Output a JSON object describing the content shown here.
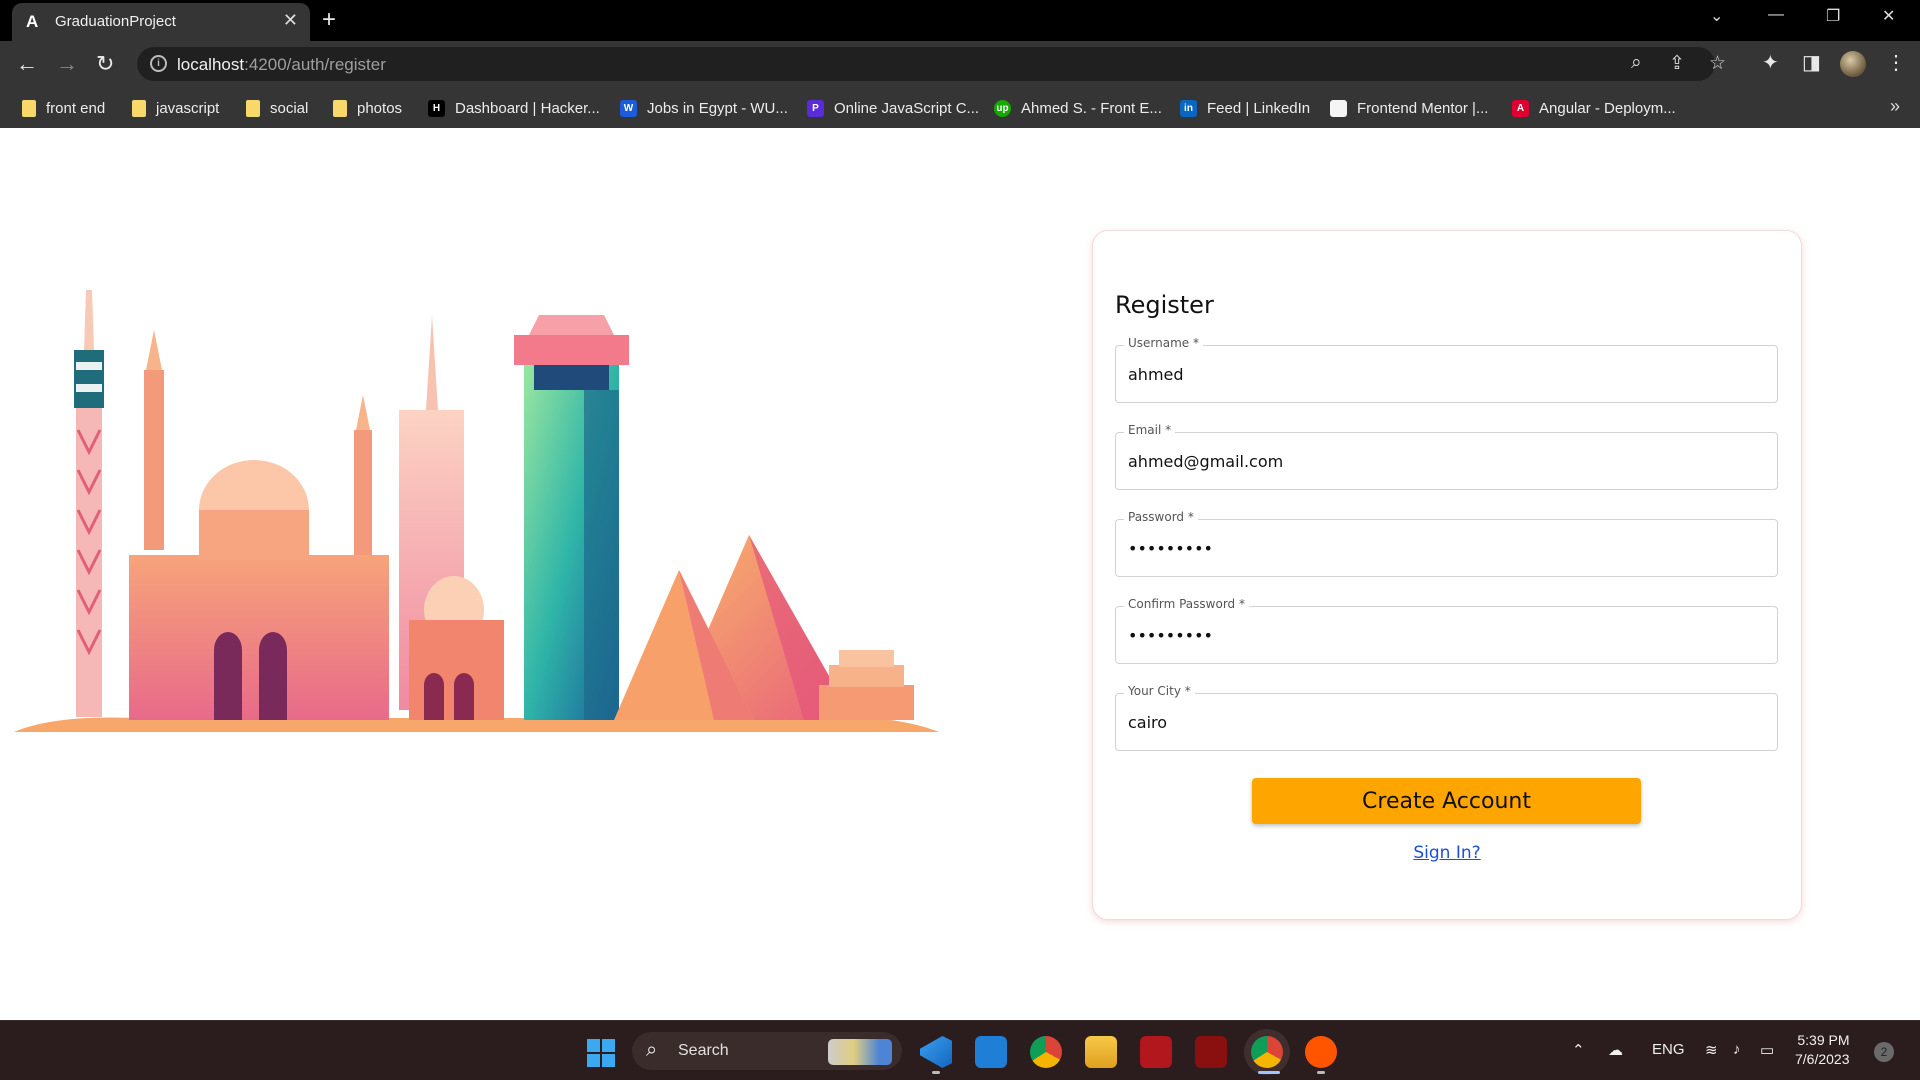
{
  "browser": {
    "tab_title": "GraduationProject",
    "tab_favicon": "A",
    "url_host": "localhost",
    "url_rest": ":4200/auth/register",
    "bookmarks": [
      {
        "label": "front end",
        "icon": "folder-icon"
      },
      {
        "label": "javascript",
        "icon": "folder-icon"
      },
      {
        "label": "social",
        "icon": "folder-icon"
      },
      {
        "label": "photos",
        "icon": "folder-icon"
      },
      {
        "label": "Dashboard | Hacker...",
        "icon": "hackerrank-icon",
        "icon_text": "H",
        "icon_color": "#000000"
      },
      {
        "label": "Jobs in Egypt - WU...",
        "icon": "wuzzuf-icon",
        "icon_text": "W",
        "icon_color": "#1c5bd9"
      },
      {
        "label": "Online JavaScript C...",
        "icon": "programiz-icon",
        "icon_text": "P",
        "icon_color": "#5a2bd8"
      },
      {
        "label": "Ahmed S. - Front E...",
        "icon": "upwork-icon",
        "icon_text": "up",
        "icon_color": "#14a800"
      },
      {
        "label": "Feed | LinkedIn",
        "icon": "linkedin-icon",
        "icon_text": "in",
        "icon_color": "#0a66c2"
      },
      {
        "label": "Frontend Mentor |...",
        "icon": "frontend-mentor-icon",
        "icon_text": "",
        "icon_color": "#f5f5f5"
      },
      {
        "label": "Angular - Deploym...",
        "icon": "angular-icon",
        "icon_text": "A",
        "icon_color": "#dd0031"
      }
    ]
  },
  "form": {
    "title": "Register",
    "fields": [
      {
        "label": "Username *",
        "value": "ahmed"
      },
      {
        "label": "Email *",
        "value": "ahmed@gmail.com"
      },
      {
        "label": "Password *",
        "value": "•••••••••"
      },
      {
        "label": "Confirm Password *",
        "value": "•••••••••"
      },
      {
        "label": "Your City *",
        "value": "cairo"
      }
    ],
    "submit_label": "Create Account",
    "signin_link": "Sign In?"
  },
  "taskbar": {
    "search_label": "Search",
    "language": "ENG",
    "time": "5:39 PM",
    "date": "7/6/2023",
    "notification_count": "2"
  },
  "colors": {
    "accent_button": "#ffa500",
    "link": "#1a4fd8"
  }
}
